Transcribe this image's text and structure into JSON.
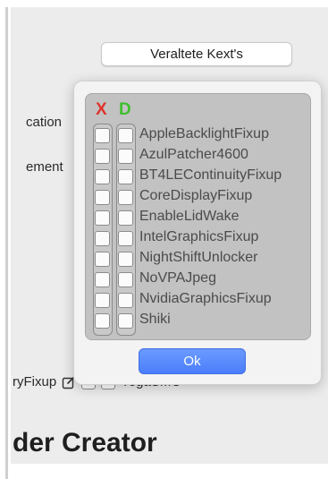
{
  "window": {
    "partial_labels": {
      "cation": "cation",
      "ement": "ement",
      "ryFixup": "ryFixup",
      "yogasmc": "YogaSMC"
    },
    "heading": "der Creator"
  },
  "tab": {
    "label": "Veraltete Kext's"
  },
  "popover": {
    "columns": {
      "x": "X",
      "d": "D"
    },
    "kexts": [
      {
        "label": "AppleBacklightFixup"
      },
      {
        "label": "AzulPatcher4600"
      },
      {
        "label": "BT4LEContinuityFixup"
      },
      {
        "label": "CoreDisplayFixup"
      },
      {
        "label": "EnableLidWake"
      },
      {
        "label": "IntelGraphicsFixup"
      },
      {
        "label": "NightShiftUnlocker"
      },
      {
        "label": "NoVPAJpeg"
      },
      {
        "label": "NvidiaGraphicsFixup"
      },
      {
        "label": "Shiki"
      }
    ],
    "ok_label": "Ok"
  },
  "colors": {
    "x": "#e0322c",
    "d": "#3fbf2e",
    "accent": "#4a7dfb"
  },
  "icons": {
    "edit": "edit-icon"
  }
}
